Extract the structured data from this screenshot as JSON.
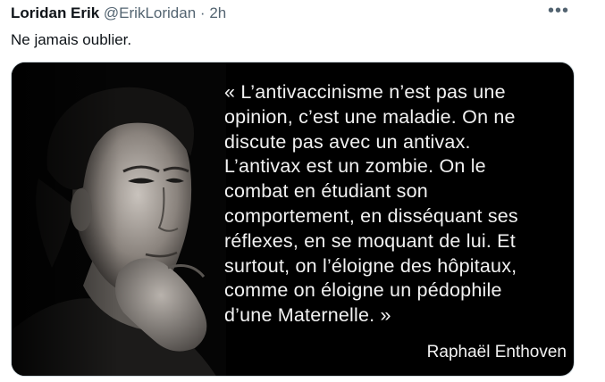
{
  "tweet": {
    "author_name": "Loridan Erik",
    "handle": "@ErikLoridan",
    "separator": "·",
    "time": "2h",
    "more_label": "•••",
    "text": "Ne jamais oublier."
  },
  "media": {
    "quote_lines": [
      "« L’antivaccinisme n’est pas une",
      "opinion, c’est une maladie. On ne",
      "discute pas avec un antivax.",
      "L’antivax est un zombie. On le",
      "combat en étudiant son",
      "comportement, en disséquant ses",
      "réflexes, en se moquant de lui. Et",
      "surtout, on l’éloigne des hôpitaux,",
      "comme on éloigne un pédophile",
      "d’une Maternelle. »"
    ],
    "attribution": "Raphaël Enthoven"
  }
}
